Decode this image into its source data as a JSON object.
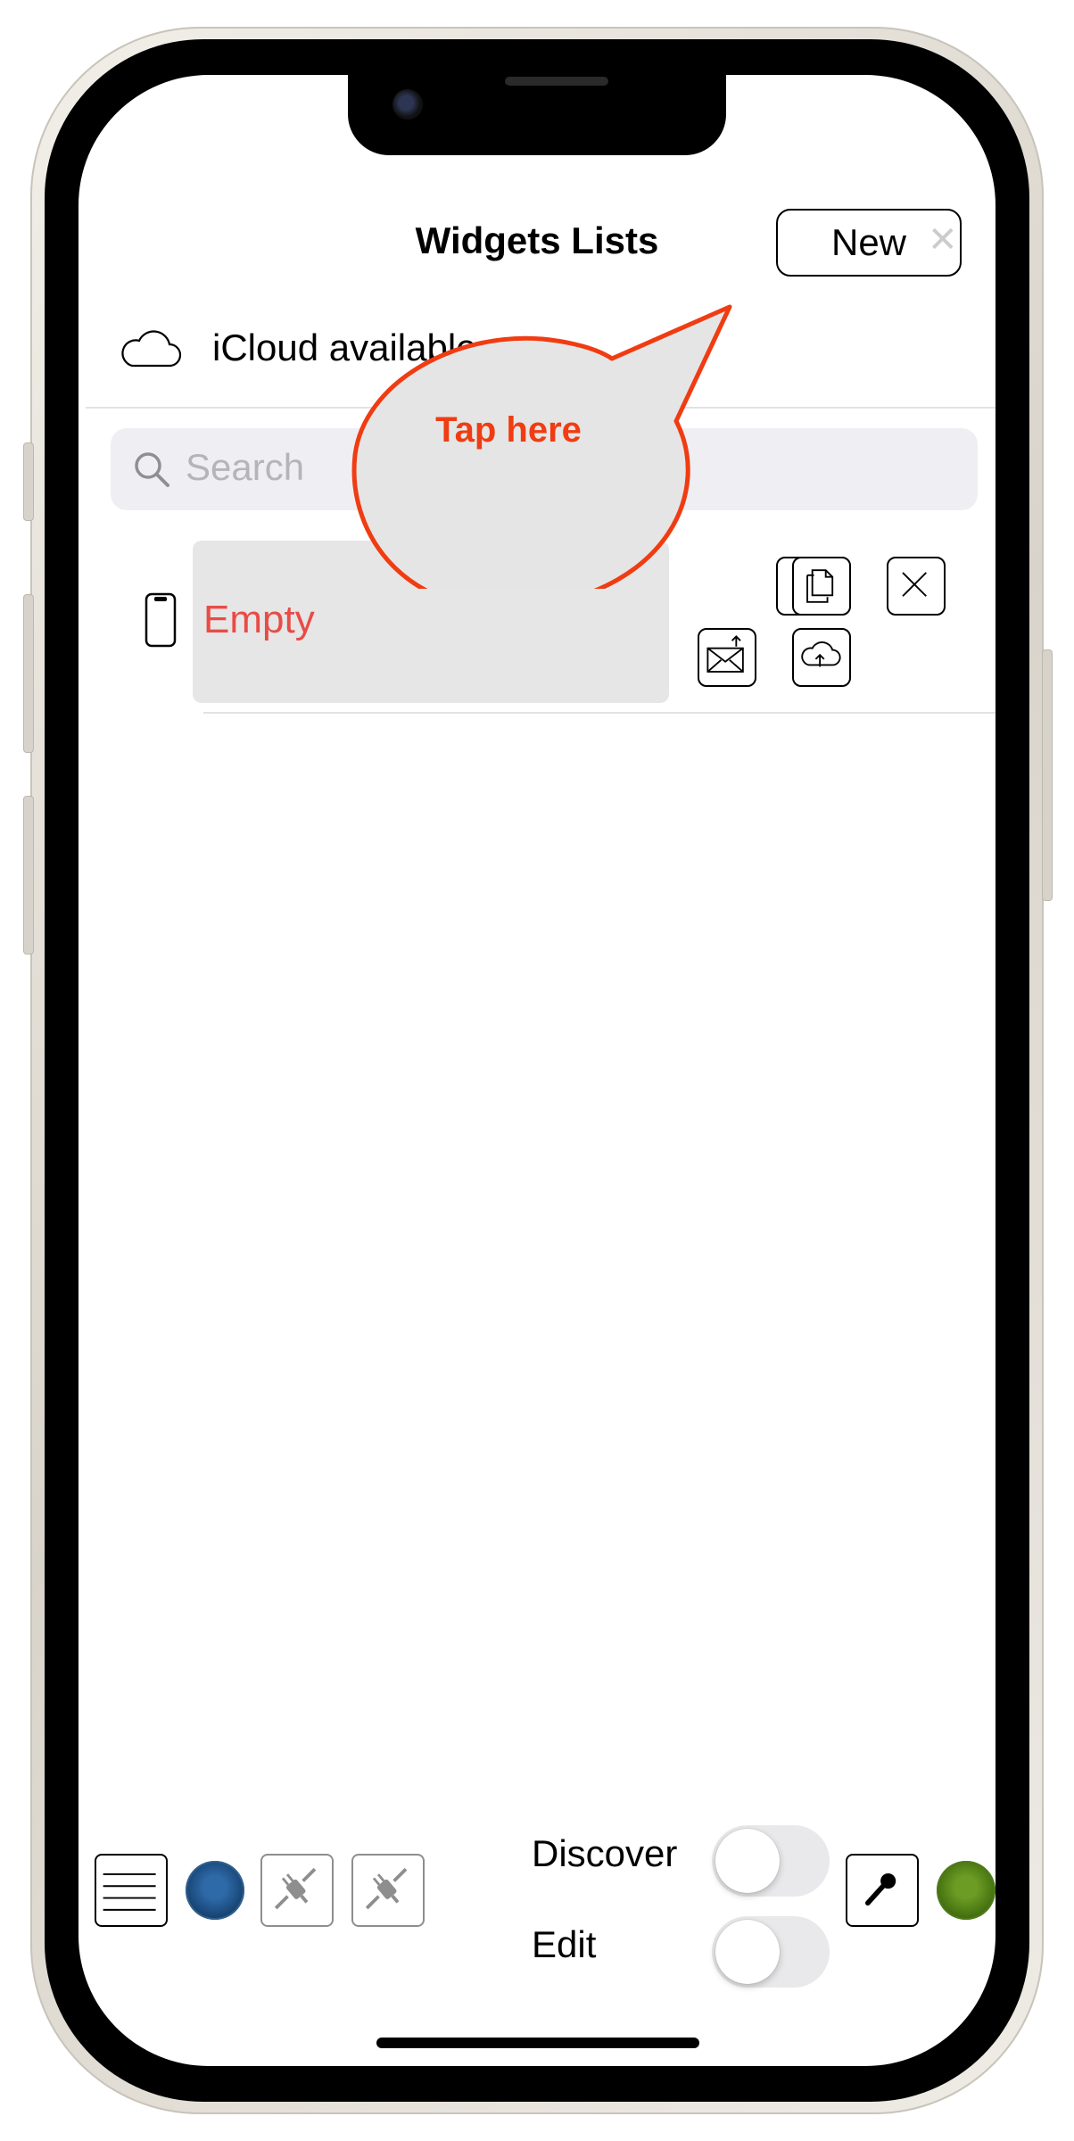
{
  "header": {
    "title": "Widgets Lists",
    "new_label": "New"
  },
  "icloud": {
    "status": "iCloud available"
  },
  "search": {
    "placeholder": "Search"
  },
  "list": {
    "items": [
      {
        "label": "Empty",
        "label_color": "#e94b47"
      }
    ]
  },
  "callout": {
    "text": "Tap here",
    "color": "#f03c12"
  },
  "toolbar": {
    "discover_label": "Discover",
    "discover_on": false,
    "edit_label": "Edit",
    "edit_on": false
  },
  "icons": [
    "cloud-icon",
    "search-icon",
    "phone-icon",
    "duplicate-icon",
    "close-icon",
    "mail-export-icon",
    "cloud-upload-icon",
    "menu-icon",
    "plug-icon",
    "microphone-icon"
  ]
}
